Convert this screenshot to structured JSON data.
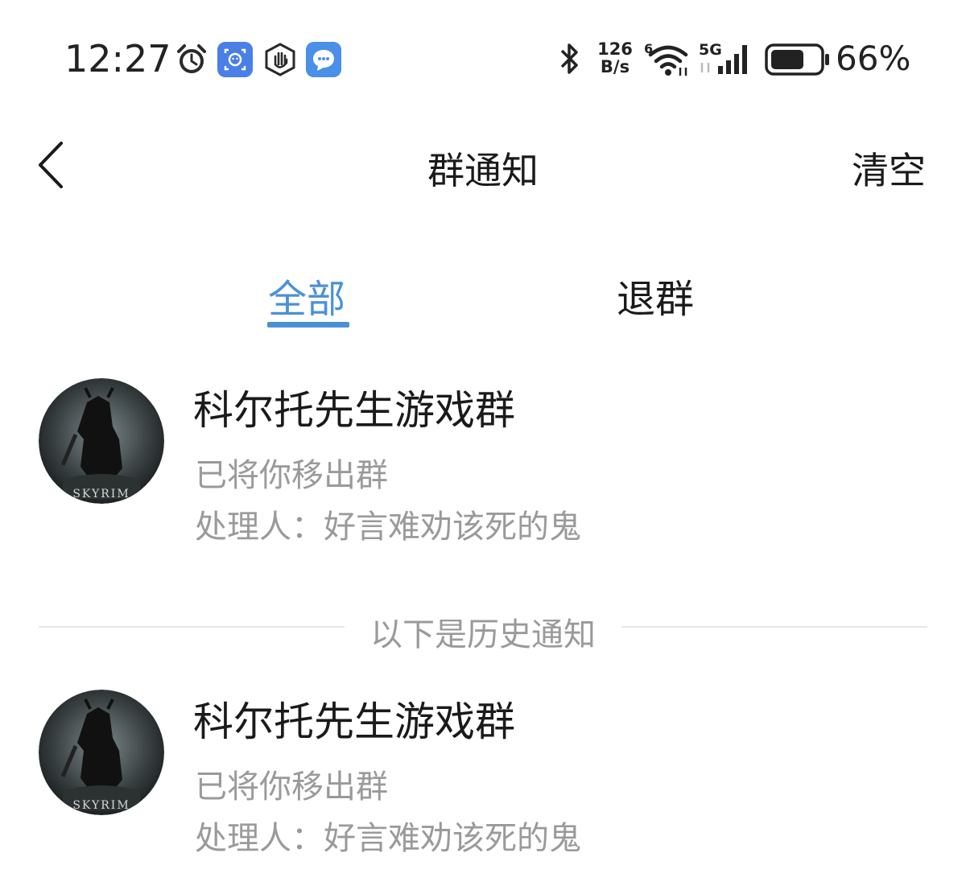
{
  "status_bar": {
    "time": "12:27",
    "net_speed_value": "126",
    "net_speed_unit": "B/s",
    "battery_percent": "66%",
    "icons": [
      "alarm-icon",
      "face-unlock-app-icon",
      "hand-stop-app-icon",
      "message-app-icon",
      "bluetooth-icon",
      "wifi-icon",
      "cellular-5g-icon",
      "battery-icon"
    ]
  },
  "header": {
    "title": "群通知",
    "clear_label": "清空"
  },
  "tabs": [
    {
      "label": "全部",
      "active": true
    },
    {
      "label": "退群",
      "active": false
    }
  ],
  "notifications": [
    {
      "group_name": "科尔托先生游戏群",
      "action": "已将你移出群",
      "handler": "处理人：好言难劝该死的鬼"
    }
  ],
  "history_divider": "以下是历史通知",
  "history": [
    {
      "group_name": "科尔托先生游戏群",
      "action": "已将你移出群",
      "handler": "处理人：好言难劝该死的鬼"
    }
  ],
  "avatar_logo_text": "SKYRIM",
  "colors": {
    "accent": "#4a90d9",
    "secondary_text": "#9a9a9a",
    "divider": "#e6e6e6"
  }
}
